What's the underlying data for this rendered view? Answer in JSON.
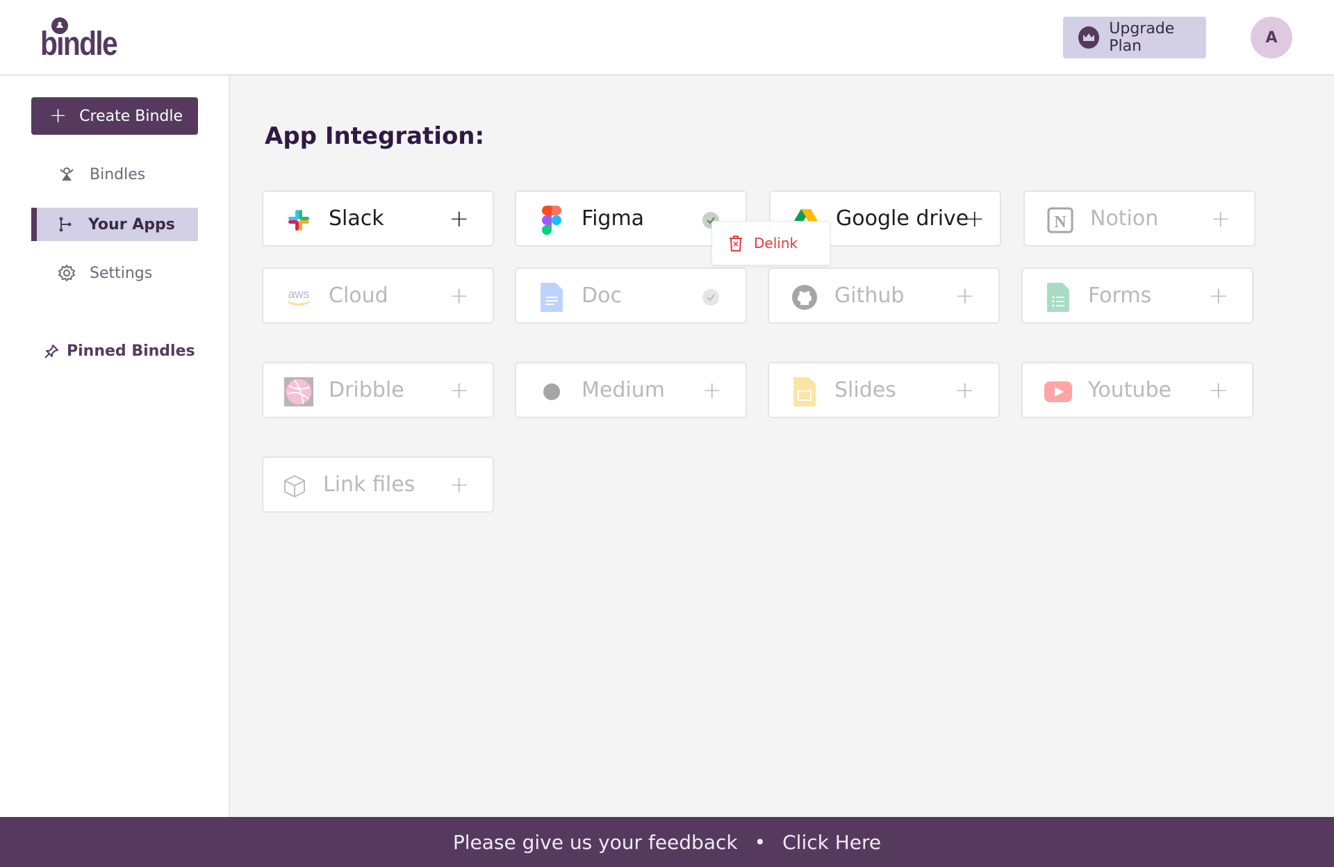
{
  "header": {
    "logo_text": "bindle",
    "upgrade_label": "Upgrade Plan",
    "avatar_initial": "A"
  },
  "sidebar": {
    "create_label": "Create Bindle",
    "items": [
      {
        "label": "Bindles",
        "icon": "bindle-icon",
        "active": false
      },
      {
        "label": "Your Apps",
        "icon": "apps-icon",
        "active": true
      },
      {
        "label": "Settings",
        "icon": "gear-icon",
        "active": false
      }
    ],
    "pinned_label": "Pinned Bindles"
  },
  "main": {
    "title": "App Integration:",
    "apps": [
      {
        "name": "Slack",
        "icon": "slack-icon",
        "status": "add",
        "enabled": true
      },
      {
        "name": "Figma",
        "icon": "figma-icon",
        "status": "linked",
        "enabled": true
      },
      {
        "name": "Google drive",
        "icon": "google-drive-icon",
        "status": "add",
        "enabled": true
      },
      {
        "name": "Notion",
        "icon": "notion-icon",
        "status": "add",
        "enabled": false
      },
      {
        "name": "Cloud",
        "icon": "aws-icon",
        "status": "add",
        "enabled": false
      },
      {
        "name": "Doc",
        "icon": "google-docs-icon",
        "status": "linked",
        "enabled": false
      },
      {
        "name": "Github",
        "icon": "github-icon",
        "status": "add",
        "enabled": false
      },
      {
        "name": "Forms",
        "icon": "google-forms-icon",
        "status": "add",
        "enabled": false
      },
      {
        "name": "Dribble",
        "icon": "dribbble-icon",
        "status": "add",
        "enabled": false
      },
      {
        "name": "Medium",
        "icon": "medium-icon",
        "status": "add",
        "enabled": false
      },
      {
        "name": "Slides",
        "icon": "google-slides-icon",
        "status": "add",
        "enabled": false
      },
      {
        "name": "Youtube",
        "icon": "youtube-icon",
        "status": "add",
        "enabled": false
      },
      {
        "name": "Link files",
        "icon": "cube-icon",
        "status": "add",
        "enabled": false
      }
    ],
    "popup": {
      "label": "Delink",
      "icon": "trash-icon"
    },
    "add_symbol": "+"
  },
  "footer": {
    "text": "Please give us your feedback",
    "separator": "•",
    "link_label": "Click Here"
  },
  "colors": {
    "brand": "#553a5e",
    "accent_light": "#d3cfe5",
    "danger": "#e63a3a"
  }
}
